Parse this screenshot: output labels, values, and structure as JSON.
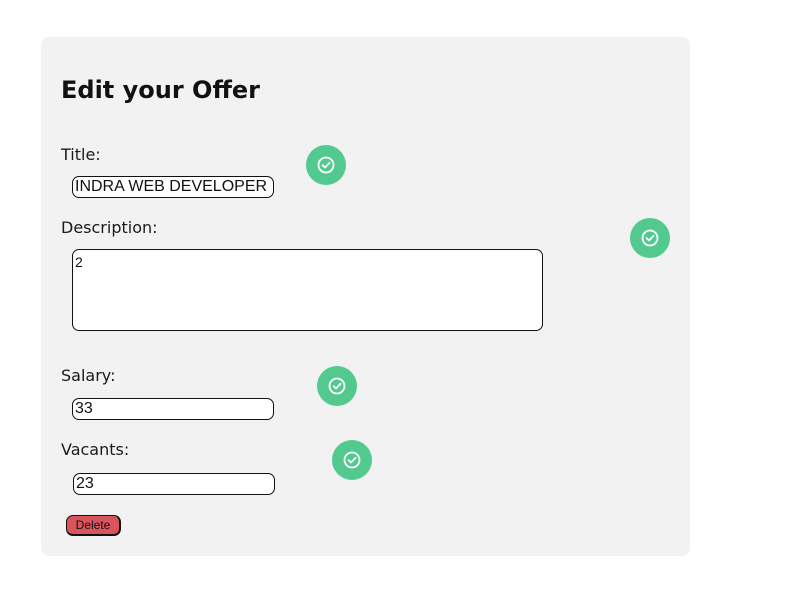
{
  "form": {
    "heading": "Edit your Offer",
    "title_label": "Title:",
    "title_value": "INDRA WEB DEVELOPER",
    "description_label": "Description:",
    "description_value": "2",
    "salary_label": "Salary:",
    "salary_value": "33",
    "vacants_label": "Vacants:",
    "vacants_value": "23",
    "delete_label": "Delete"
  },
  "icons": {
    "confirm": "check-circle-icon"
  },
  "colors": {
    "card_background": "#f2f2f2",
    "confirm_button": "#52c98f",
    "delete_button": "#d9545d"
  }
}
